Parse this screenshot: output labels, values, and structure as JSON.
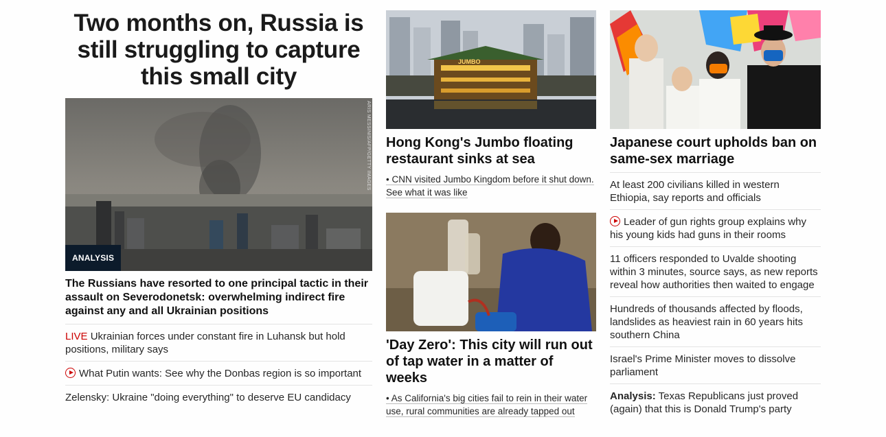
{
  "left": {
    "headline": "Two months on, Russia is still struggling to capture this small city",
    "badge": "ANALYSIS",
    "credit": "ARIS MESSINIS/AFP/GETTY IMAGES",
    "lead": "The Russians have resorted to one principal tactic in their assault on Severodonetsk: overwhelming indirect fire against any and all Ukrainian positions",
    "links": [
      {
        "prefix": "LIVE",
        "text": "Ukrainian forces under constant fire in Luhansk but hold positions, military says"
      },
      {
        "icon": "play-icon",
        "text": "What Putin wants: See why the Donbas region is so important"
      },
      {
        "text": "Zelensky: Ukraine \"doing everything\" to deserve EU candidacy"
      }
    ]
  },
  "middle": {
    "card1": {
      "title": "Hong Kong's Jumbo floating restaurant sinks at sea",
      "sub": "• CNN visited Jumbo Kingdom before it shut down. See what it was like",
      "sign": "JUMBO"
    },
    "card2": {
      "title": "'Day Zero': This city will run out of tap water in a matter of weeks",
      "sub": "• As California's big cities fail to rein in their water use, rural communities are already tapped out"
    }
  },
  "right": {
    "card_title": "Japanese court upholds ban on same-sex marriage",
    "links": [
      {
        "text": "At least 200 civilians killed in western Ethiopia, say reports and officials"
      },
      {
        "icon": "play-icon",
        "text": "Leader of gun rights group explains why his young kids had guns in their rooms"
      },
      {
        "text": "11 officers responded to Uvalde shooting within 3 minutes, source says, as new reports reveal how authorities then waited to engage"
      },
      {
        "text": "Hundreds of thousands affected by floods, landslides as heaviest rain in 60 years hits southern China"
      },
      {
        "text": "Israel's Prime Minister moves to dissolve parliament"
      },
      {
        "prefix": "Analysis:",
        "text": "Texas Republicans just proved (again) that this is Donald Trump's party"
      }
    ]
  }
}
